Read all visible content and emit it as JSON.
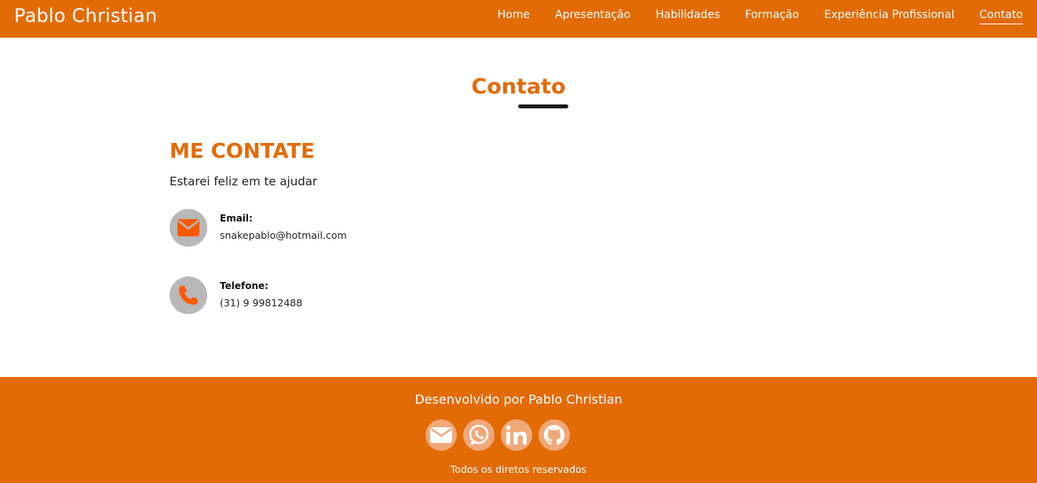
{
  "navbar": {
    "brand": "Pablo Christian",
    "items": [
      {
        "label": "Home",
        "active": false
      },
      {
        "label": "Apresentação",
        "active": false
      },
      {
        "label": "Habilidades",
        "active": false
      },
      {
        "label": "Formação",
        "active": false
      },
      {
        "label": "Experiência Profissional",
        "active": false
      },
      {
        "label": "Contato",
        "active": true
      }
    ]
  },
  "section": {
    "title": "Contato"
  },
  "contact": {
    "heading": "ME CONTATE",
    "subtitle": "Estarei feliz em te ajudar",
    "email": {
      "label": "Email:",
      "value": "snakepablo@hotmail.com",
      "icon": "envelope-icon"
    },
    "phone": {
      "label": "Telefone:",
      "value": "(31) 9 99812488",
      "icon": "phone-icon"
    }
  },
  "footer": {
    "credit": "Desenvolvido por Pablo Christian",
    "social": [
      {
        "name": "email",
        "icon": "envelope-icon"
      },
      {
        "name": "whatsapp",
        "icon": "whatsapp-icon"
      },
      {
        "name": "linkedin",
        "icon": "linkedin-icon"
      },
      {
        "name": "github",
        "icon": "github-icon"
      }
    ],
    "rights": "Todos os diretos reservados"
  },
  "colors": {
    "accent": "#e36b06",
    "icon_circle": "#b8b8b8",
    "social_circle": "#f0a878",
    "dark": "#1b1b1b"
  }
}
